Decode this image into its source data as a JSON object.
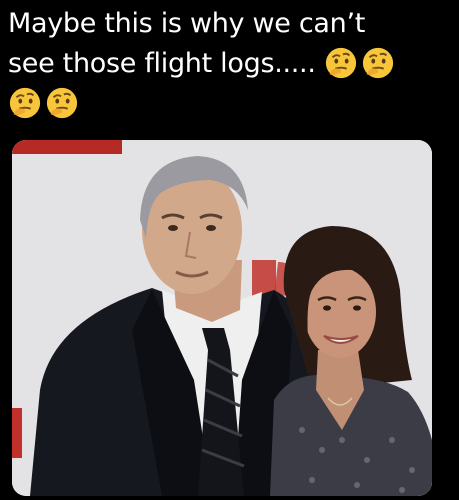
{
  "caption": {
    "line1": "Maybe this is why we can’t",
    "line2": "see those flight logs.....",
    "emojis": [
      "thinking-face-emoji",
      "thinking-face-emoji",
      "thinking-face-emoji",
      "thinking-face-emoji"
    ]
  },
  "photo": {
    "description_icon": "photo-of-two-people-at-event",
    "backdrop_color": "#e3e3e5",
    "backdrop_accent": "#c0312b"
  }
}
